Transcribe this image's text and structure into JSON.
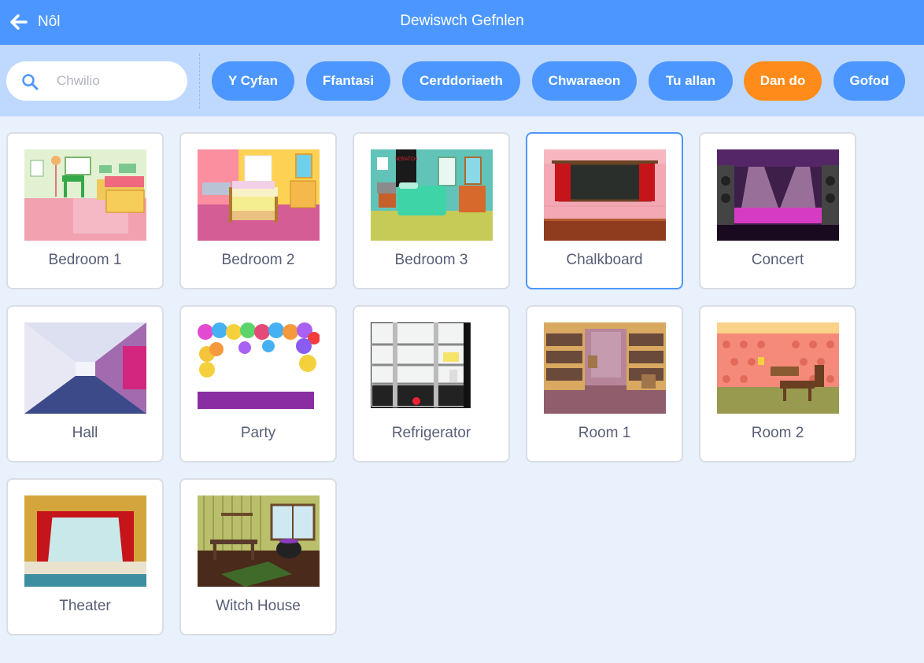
{
  "header": {
    "back_label": "Nôl",
    "title": "Dewiswch Gefnlen"
  },
  "search": {
    "placeholder": "Chwilio",
    "value": ""
  },
  "tags": [
    {
      "label": "Y Cyfan",
      "active": false
    },
    {
      "label": "Ffantasi",
      "active": false
    },
    {
      "label": "Cerddoriaeth",
      "active": false
    },
    {
      "label": "Chwaraeon",
      "active": false
    },
    {
      "label": "Tu allan",
      "active": false
    },
    {
      "label": "Dan do",
      "active": true
    },
    {
      "label": "Gofod",
      "active": false
    }
  ],
  "colors": {
    "header": "#4c97ff",
    "filterbar": "#bfd8fe",
    "active_tag": "#ff8c1a",
    "background": "#e9f1fc",
    "text": "#575e75"
  },
  "backdrops": [
    {
      "name": "Bedroom 1",
      "selected": false
    },
    {
      "name": "Bedroom 2",
      "selected": false
    },
    {
      "name": "Bedroom 3",
      "selected": false
    },
    {
      "name": "Chalkboard",
      "selected": true
    },
    {
      "name": "Concert",
      "selected": false
    },
    {
      "name": "Hall",
      "selected": false
    },
    {
      "name": "Party",
      "selected": false
    },
    {
      "name": "Refrigerator",
      "selected": false
    },
    {
      "name": "Room 1",
      "selected": false
    },
    {
      "name": "Room 2",
      "selected": false
    },
    {
      "name": "Theater",
      "selected": false
    },
    {
      "name": "Witch House",
      "selected": false
    }
  ]
}
